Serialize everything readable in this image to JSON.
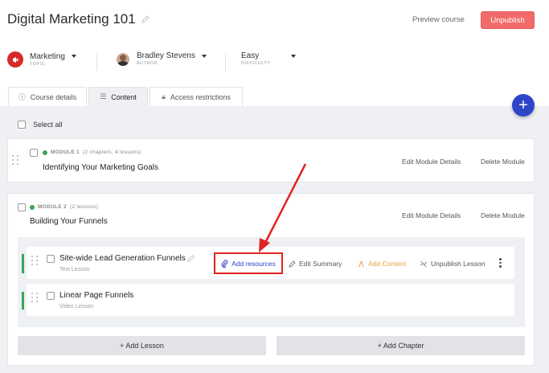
{
  "header": {
    "title": "Digital Marketing 101",
    "preview_label": "Preview course",
    "unpublish_label": "Unpublish"
  },
  "meta": {
    "topic": {
      "value": "Marketing",
      "label": "TOPIC"
    },
    "author": {
      "value": "Bradley Stevens",
      "label": "AUTHOR"
    },
    "difficulty": {
      "value": "Easy",
      "label": "DIFFICULTY"
    }
  },
  "tabs": [
    {
      "label": "Course details",
      "icon": "info-icon"
    },
    {
      "label": "Content",
      "icon": "list-icon",
      "active": true
    },
    {
      "label": "Access restrictions",
      "icon": "lock-icon"
    }
  ],
  "content": {
    "select_all": "Select all",
    "fab_label": "+",
    "modules": [
      {
        "label": "MODULE 1",
        "summary": "(2 chapters, 4 lessons)",
        "title": "Identifying Your Marketing Goals",
        "edit_label": "Edit Module Details",
        "delete_label": "Delete Module"
      },
      {
        "label": "MODULE 2",
        "summary": "(2 lessons)",
        "title": "Building Your Funnels",
        "edit_label": "Edit Module Details",
        "delete_label": "Delete Module"
      }
    ],
    "lessons": [
      {
        "title": "Site-wide Lead Generation Funnels",
        "type": "Text Lesson"
      },
      {
        "title": "Linear Page Funnels",
        "type": "Video Lesson"
      }
    ],
    "actions": {
      "add_resources": "Add resources",
      "edit_summary": "Edit Summary",
      "add_content": "Add Content",
      "unpublish_lesson": "Unpublish Lesson"
    },
    "add_lesson": "+ Add Lesson",
    "add_chapter": "+ Add Chapter"
  },
  "colors": {
    "accent_blue": "#2f45c8",
    "unpublish_red": "#f26b6b",
    "status_green": "#3aa655",
    "add_content_orange": "#e6a23c",
    "annotation_red": "#e22222"
  }
}
